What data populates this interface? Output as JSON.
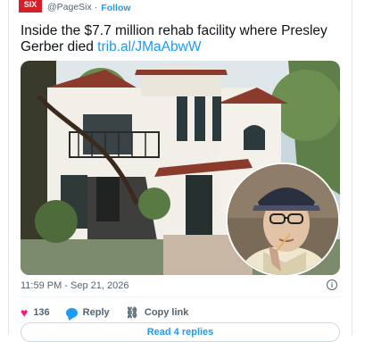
{
  "header": {
    "avatar_text": "SIX",
    "handle": "@PageSix",
    "separator": "·",
    "follow_label": "Follow"
  },
  "tweet": {
    "text": "Inside the $7.7 million rehab facility where Presley Gerber died",
    "link": "trib.al/JMaAbwW"
  },
  "meta": {
    "timestamp": "11:59 PM - Sep 21, 2026",
    "info_icon_glyph": "i"
  },
  "actions": {
    "likes_count": "136",
    "reply_label": "Reply",
    "copy_link_label": "Copy link",
    "read_replies_label": "Read 4 replies"
  },
  "icons": {
    "heart": "heart-icon",
    "reply": "reply-bubble-icon",
    "copy": "link-icon",
    "info": "info-icon"
  },
  "colors": {
    "accent": "#1d9bf0",
    "like": "#f91880",
    "muted": "#536471",
    "brand": "#d4202a"
  }
}
